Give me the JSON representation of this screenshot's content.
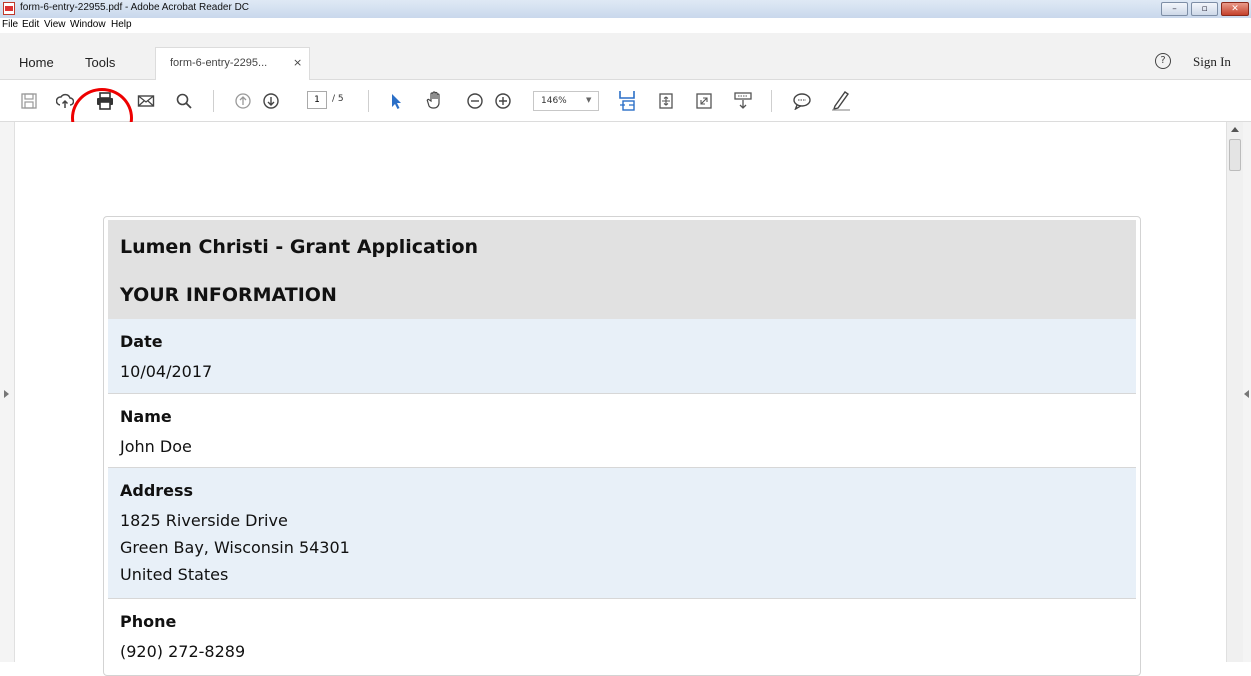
{
  "window": {
    "title": "form-6-entry-22955.pdf - Adobe Acrobat Reader DC"
  },
  "menu": [
    "File",
    "Edit",
    "View",
    "Window",
    "Help"
  ],
  "tabs": {
    "home": "Home",
    "tools": "Tools",
    "document": "form-6-entry-2295...",
    "close": "×"
  },
  "header_right": {
    "help": "?",
    "signin": "Sign In"
  },
  "toolbar": {
    "page_current": "1",
    "page_total": "/ 5",
    "zoom": "146%",
    "zoom_caret": "▼",
    "icons": [
      "save-icon",
      "cloud-upload-icon",
      "print-icon",
      "email-icon",
      "search-icon",
      "page-up-icon",
      "page-down-icon",
      "select-arrow-icon",
      "hand-icon",
      "zoom-out-icon",
      "zoom-in-icon",
      "fit-width-icon",
      "fit-page-icon",
      "full-screen-icon",
      "reading-mode-icon",
      "comment-icon",
      "pen-icon"
    ]
  },
  "form": {
    "title": "Lumen Christi - Grant Application",
    "section": "YOUR INFORMATION",
    "fields": [
      {
        "label": "Date",
        "value": "10/04/2017"
      },
      {
        "label": "Name",
        "value": "John Doe"
      },
      {
        "label": "Address",
        "lines": [
          "1825 Riverside Drive",
          "Green Bay, Wisconsin 54301",
          "United States"
        ]
      },
      {
        "label": "Phone",
        "value": "(920) 272-8289"
      }
    ]
  },
  "colors": {
    "accent_blue": "#2b6fc7",
    "annotation_red": "#e00000",
    "row_alt": "#e8f0f8",
    "header_gray": "#e1e1e1"
  }
}
